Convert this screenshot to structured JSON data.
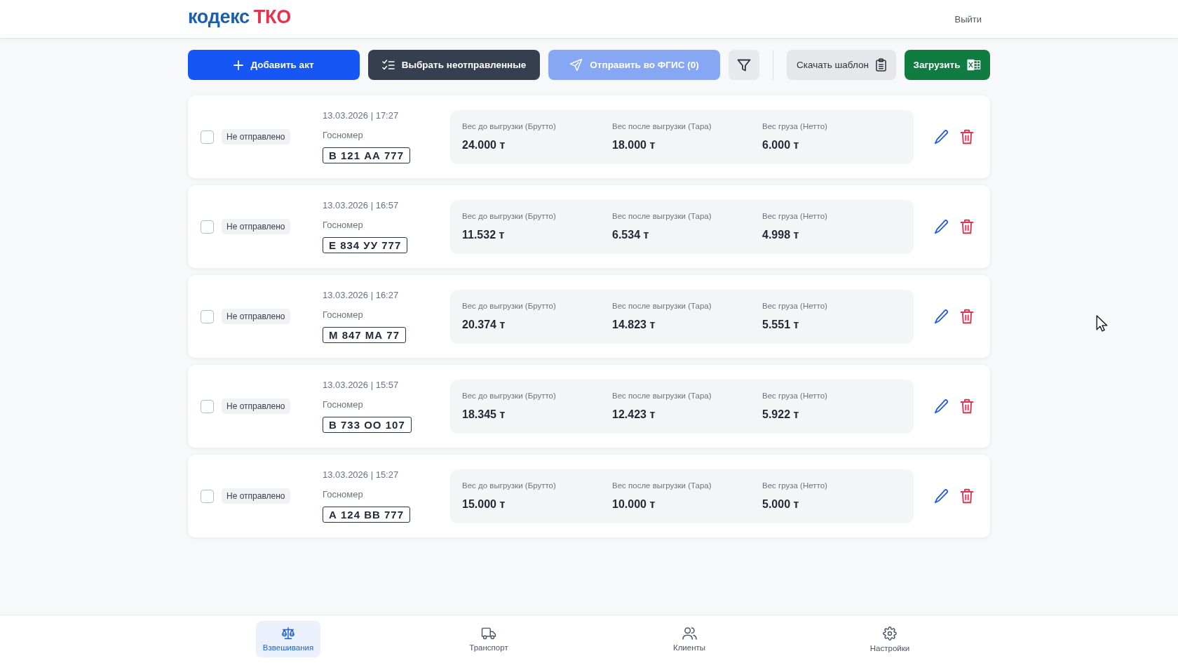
{
  "header": {
    "logo": {
      "text": "кодекс",
      "accent": "ТКО"
    },
    "logout": "Выйти"
  },
  "toolbar": {
    "actions": [
      {
        "kind": "add",
        "label": "Добавить акт",
        "disabled": false
      },
      {
        "kind": "select",
        "label": "Выбрать неотправленные",
        "disabled": false
      },
      {
        "kind": "send",
        "label": "Отправить во ФГИС (0)",
        "disabled": true
      },
      {
        "kind": "filter",
        "disabled": false
      }
    ],
    "file_actions": [
      {
        "kind": "template",
        "label": "Скачать шаблон",
        "disabled": false
      },
      {
        "kind": "upload",
        "label": "Загрузить",
        "disabled": false
      }
    ]
  },
  "acts": [
    {
      "checked": false,
      "status": "Не отправлено",
      "datetime": "13.03.2026 | 17:27",
      "plate_label": "Госномер",
      "plate": "В 121 АА 777",
      "weights": [
        {
          "label": "Вес до выгрузки (Брутто)",
          "value": "24.000 т"
        },
        {
          "label": "Вес после выгрузки (Тара)",
          "value": "18.000 т"
        },
        {
          "label": "Вес груза (Нетто)",
          "value": "6.000 т"
        }
      ]
    },
    {
      "checked": false,
      "status": "Не отправлено",
      "datetime": "13.03.2026 | 16:57",
      "plate_label": "Госномер",
      "plate": "Е 834 УУ 777",
      "weights": [
        {
          "label": "Вес до выгрузки (Брутто)",
          "value": "11.532 т"
        },
        {
          "label": "Вес после выгрузки (Тара)",
          "value": "6.534 т"
        },
        {
          "label": "Вес груза (Нетто)",
          "value": "4.998 т"
        }
      ]
    },
    {
      "checked": false,
      "status": "Не отправлено",
      "datetime": "13.03.2026 | 16:27",
      "plate_label": "Госномер",
      "plate": "М 847 МА 77",
      "weights": [
        {
          "label": "Вес до выгрузки (Брутто)",
          "value": "20.374 т"
        },
        {
          "label": "Вес после выгрузки (Тара)",
          "value": "14.823 т"
        },
        {
          "label": "Вес груза (Нетто)",
          "value": "5.551 т"
        }
      ]
    },
    {
      "checked": false,
      "status": "Не отправлено",
      "datetime": "13.03.2026 | 15:57",
      "plate_label": "Госномер",
      "plate": "В 733 ОО 107",
      "weights": [
        {
          "label": "Вес до выгрузки (Брутто)",
          "value": "18.345 т"
        },
        {
          "label": "Вес после выгрузки (Тара)",
          "value": "12.423 т"
        },
        {
          "label": "Вес груза (Нетто)",
          "value": "5.922 т"
        }
      ]
    },
    {
      "checked": false,
      "status": "Не отправлено",
      "datetime": "13.03.2026 | 15:27",
      "plate_label": "Госномер",
      "plate": "А 124 ВВ 777",
      "weights": [
        {
          "label": "Вес до выгрузки (Брутто)",
          "value": "15.000 т"
        },
        {
          "label": "Вес после выгрузки (Тара)",
          "value": "10.000 т"
        },
        {
          "label": "Вес груза (Нетто)",
          "value": "5.000 т"
        }
      ]
    }
  ],
  "nav": {
    "items": [
      {
        "kind": "weighings",
        "label": "Взвешивания",
        "selected": true
      },
      {
        "kind": "transport",
        "label": "Транспорт",
        "selected": false
      },
      {
        "kind": "clients",
        "label": "Клиенты",
        "selected": false
      },
      {
        "kind": "settings",
        "label": "Настройки",
        "selected": false
      }
    ]
  }
}
